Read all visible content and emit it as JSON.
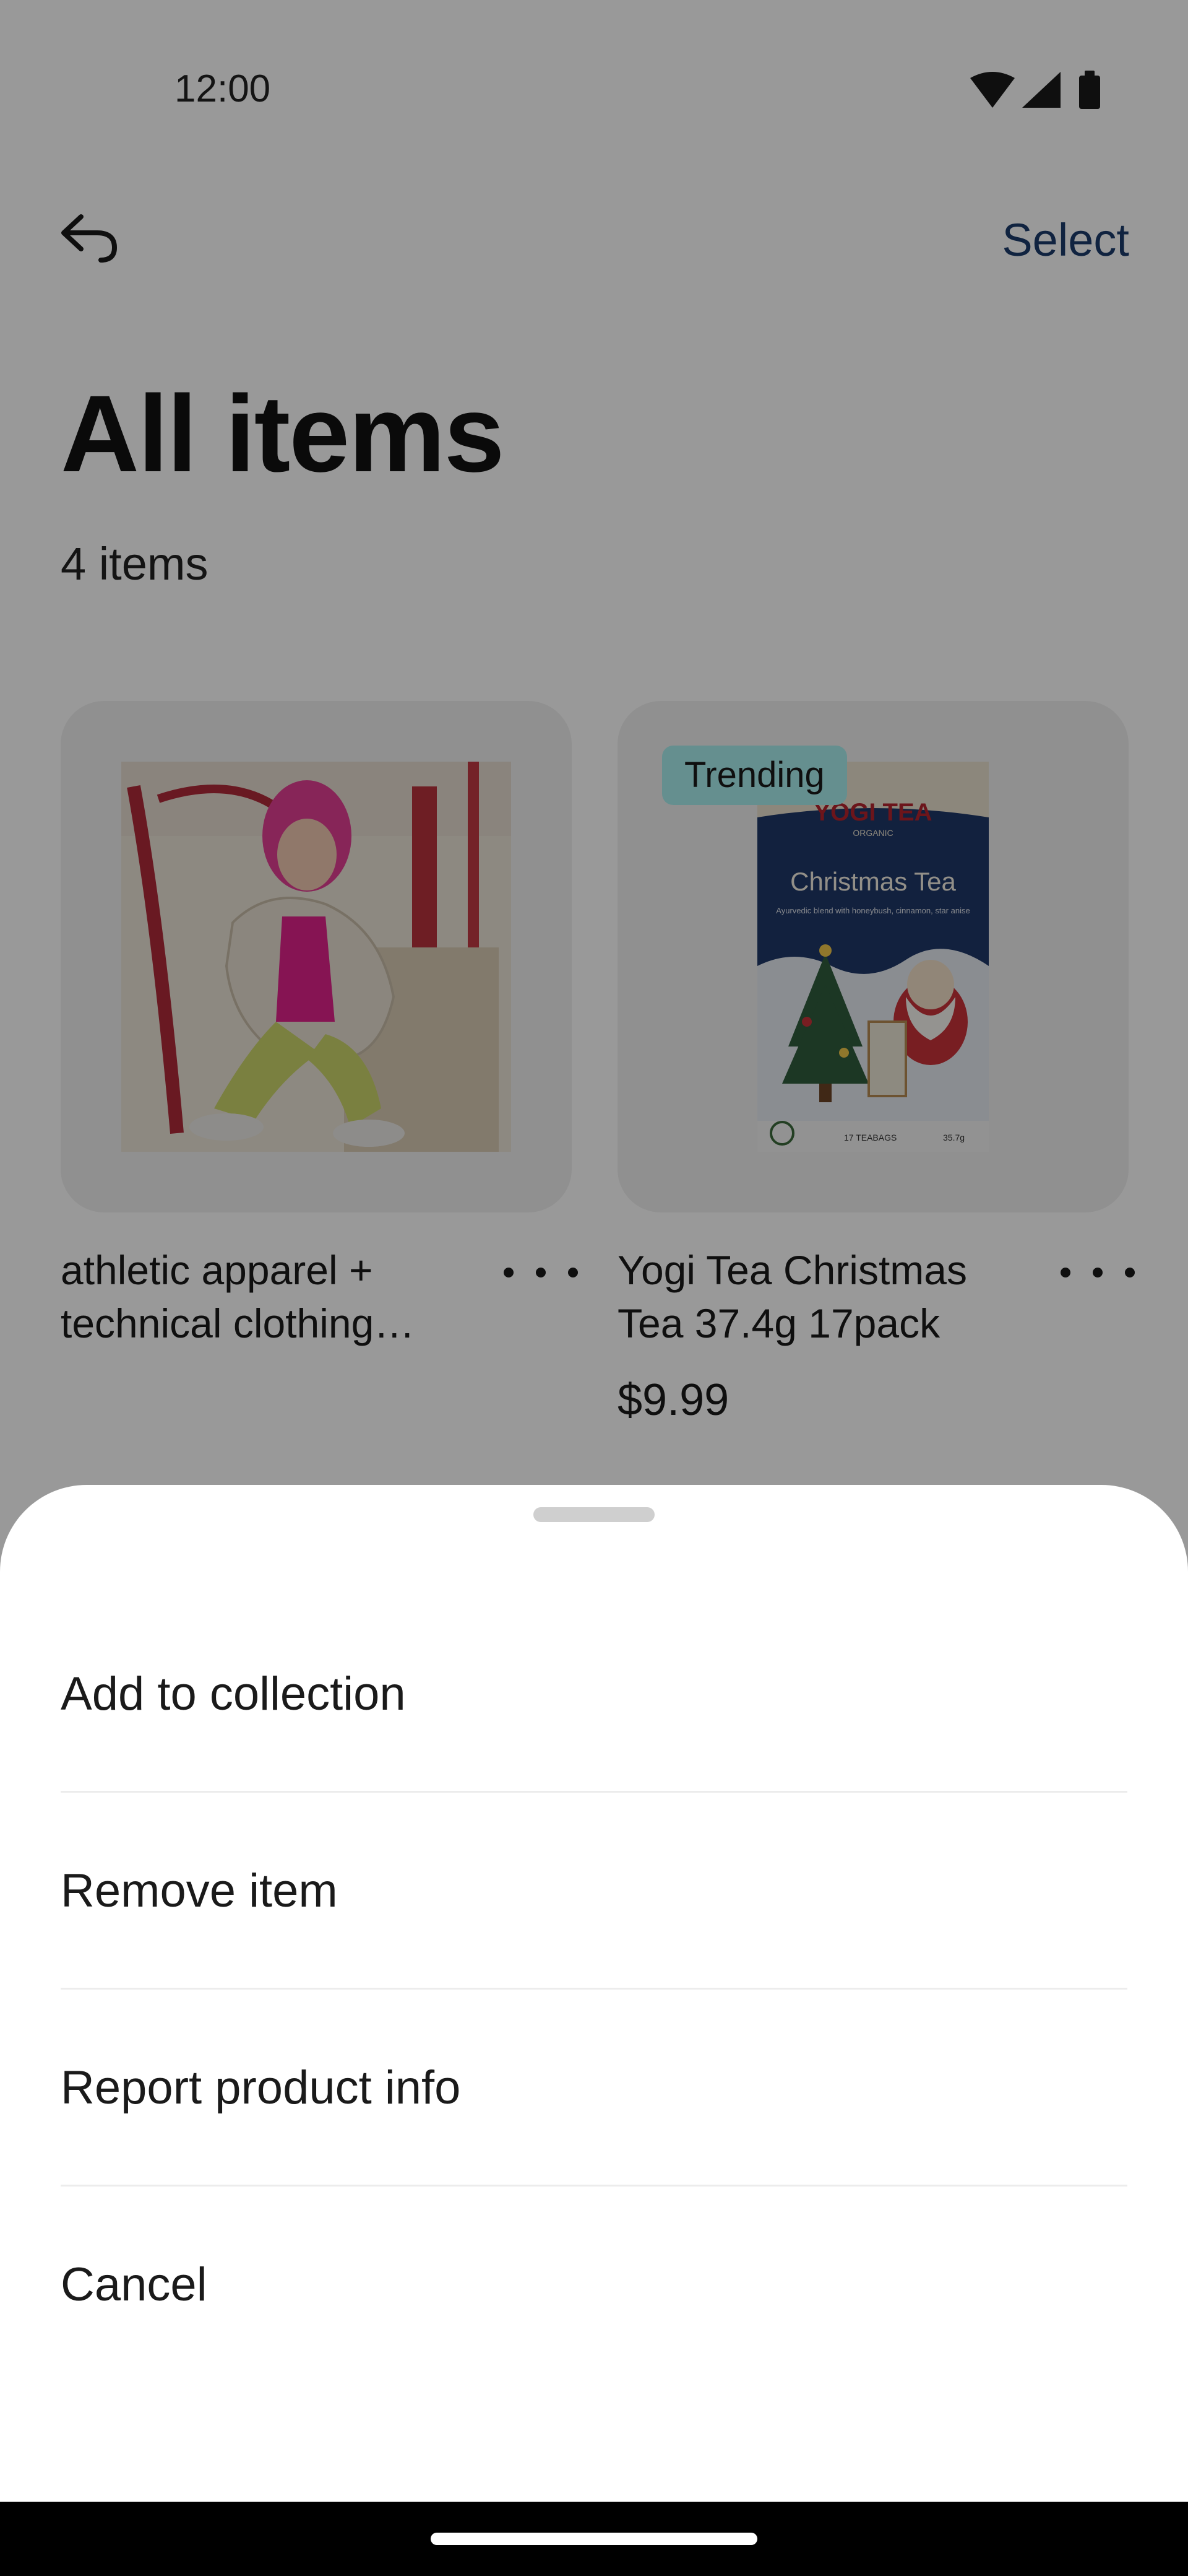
{
  "status_bar": {
    "time": "12:00"
  },
  "header": {
    "select_label": "Select"
  },
  "page": {
    "title": "All items",
    "item_count": "4 items"
  },
  "products": [
    {
      "title": "athletic apparel + technical clothing…",
      "price": "",
      "badge": ""
    },
    {
      "title": "Yogi Tea Christmas Tea 37.4g 17pack",
      "price": "$9.99",
      "badge": "Trending"
    }
  ],
  "product_image_text": {
    "brand": "YOGI TEA",
    "organic": "ORGANIC",
    "name": "Christmas Tea",
    "tagline": "Ayurvedic blend with honeybush, cinnamon, star anise",
    "count": "17 TEABAGS",
    "weight": "35.7g"
  },
  "sheet": {
    "items": [
      "Add to collection",
      "Remove item",
      "Report product info",
      "Cancel"
    ]
  },
  "icons": {
    "back": "back-arrow-icon",
    "wifi": "wifi-icon",
    "signal": "signal-icon",
    "battery": "battery-icon",
    "more": "more-horizontal-icon"
  },
  "colors": {
    "select": "#1c3b6b",
    "badge": "#a9efef",
    "card": "#f0f0f0",
    "scrim": "rgba(0,0,0,0.4)"
  }
}
